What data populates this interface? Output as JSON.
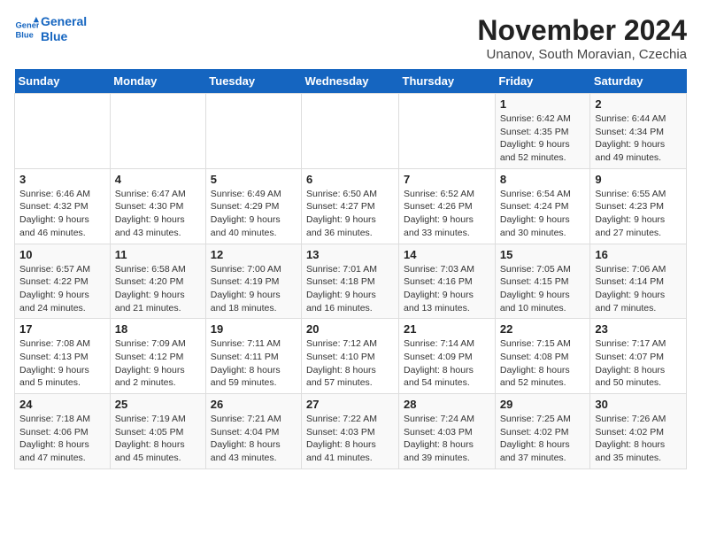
{
  "logo": {
    "line1": "General",
    "line2": "Blue"
  },
  "title": "November 2024",
  "subtitle": "Unanov, South Moravian, Czechia",
  "days_of_week": [
    "Sunday",
    "Monday",
    "Tuesday",
    "Wednesday",
    "Thursday",
    "Friday",
    "Saturday"
  ],
  "weeks": [
    [
      {
        "day": "",
        "info": ""
      },
      {
        "day": "",
        "info": ""
      },
      {
        "day": "",
        "info": ""
      },
      {
        "day": "",
        "info": ""
      },
      {
        "day": "",
        "info": ""
      },
      {
        "day": "1",
        "info": "Sunrise: 6:42 AM\nSunset: 4:35 PM\nDaylight: 9 hours and 52 minutes."
      },
      {
        "day": "2",
        "info": "Sunrise: 6:44 AM\nSunset: 4:34 PM\nDaylight: 9 hours and 49 minutes."
      }
    ],
    [
      {
        "day": "3",
        "info": "Sunrise: 6:46 AM\nSunset: 4:32 PM\nDaylight: 9 hours and 46 minutes."
      },
      {
        "day": "4",
        "info": "Sunrise: 6:47 AM\nSunset: 4:30 PM\nDaylight: 9 hours and 43 minutes."
      },
      {
        "day": "5",
        "info": "Sunrise: 6:49 AM\nSunset: 4:29 PM\nDaylight: 9 hours and 40 minutes."
      },
      {
        "day": "6",
        "info": "Sunrise: 6:50 AM\nSunset: 4:27 PM\nDaylight: 9 hours and 36 minutes."
      },
      {
        "day": "7",
        "info": "Sunrise: 6:52 AM\nSunset: 4:26 PM\nDaylight: 9 hours and 33 minutes."
      },
      {
        "day": "8",
        "info": "Sunrise: 6:54 AM\nSunset: 4:24 PM\nDaylight: 9 hours and 30 minutes."
      },
      {
        "day": "9",
        "info": "Sunrise: 6:55 AM\nSunset: 4:23 PM\nDaylight: 9 hours and 27 minutes."
      }
    ],
    [
      {
        "day": "10",
        "info": "Sunrise: 6:57 AM\nSunset: 4:22 PM\nDaylight: 9 hours and 24 minutes."
      },
      {
        "day": "11",
        "info": "Sunrise: 6:58 AM\nSunset: 4:20 PM\nDaylight: 9 hours and 21 minutes."
      },
      {
        "day": "12",
        "info": "Sunrise: 7:00 AM\nSunset: 4:19 PM\nDaylight: 9 hours and 18 minutes."
      },
      {
        "day": "13",
        "info": "Sunrise: 7:01 AM\nSunset: 4:18 PM\nDaylight: 9 hours and 16 minutes."
      },
      {
        "day": "14",
        "info": "Sunrise: 7:03 AM\nSunset: 4:16 PM\nDaylight: 9 hours and 13 minutes."
      },
      {
        "day": "15",
        "info": "Sunrise: 7:05 AM\nSunset: 4:15 PM\nDaylight: 9 hours and 10 minutes."
      },
      {
        "day": "16",
        "info": "Sunrise: 7:06 AM\nSunset: 4:14 PM\nDaylight: 9 hours and 7 minutes."
      }
    ],
    [
      {
        "day": "17",
        "info": "Sunrise: 7:08 AM\nSunset: 4:13 PM\nDaylight: 9 hours and 5 minutes."
      },
      {
        "day": "18",
        "info": "Sunrise: 7:09 AM\nSunset: 4:12 PM\nDaylight: 9 hours and 2 minutes."
      },
      {
        "day": "19",
        "info": "Sunrise: 7:11 AM\nSunset: 4:11 PM\nDaylight: 8 hours and 59 minutes."
      },
      {
        "day": "20",
        "info": "Sunrise: 7:12 AM\nSunset: 4:10 PM\nDaylight: 8 hours and 57 minutes."
      },
      {
        "day": "21",
        "info": "Sunrise: 7:14 AM\nSunset: 4:09 PM\nDaylight: 8 hours and 54 minutes."
      },
      {
        "day": "22",
        "info": "Sunrise: 7:15 AM\nSunset: 4:08 PM\nDaylight: 8 hours and 52 minutes."
      },
      {
        "day": "23",
        "info": "Sunrise: 7:17 AM\nSunset: 4:07 PM\nDaylight: 8 hours and 50 minutes."
      }
    ],
    [
      {
        "day": "24",
        "info": "Sunrise: 7:18 AM\nSunset: 4:06 PM\nDaylight: 8 hours and 47 minutes."
      },
      {
        "day": "25",
        "info": "Sunrise: 7:19 AM\nSunset: 4:05 PM\nDaylight: 8 hours and 45 minutes."
      },
      {
        "day": "26",
        "info": "Sunrise: 7:21 AM\nSunset: 4:04 PM\nDaylight: 8 hours and 43 minutes."
      },
      {
        "day": "27",
        "info": "Sunrise: 7:22 AM\nSunset: 4:03 PM\nDaylight: 8 hours and 41 minutes."
      },
      {
        "day": "28",
        "info": "Sunrise: 7:24 AM\nSunset: 4:03 PM\nDaylight: 8 hours and 39 minutes."
      },
      {
        "day": "29",
        "info": "Sunrise: 7:25 AM\nSunset: 4:02 PM\nDaylight: 8 hours and 37 minutes."
      },
      {
        "day": "30",
        "info": "Sunrise: 7:26 AM\nSunset: 4:02 PM\nDaylight: 8 hours and 35 minutes."
      }
    ]
  ]
}
